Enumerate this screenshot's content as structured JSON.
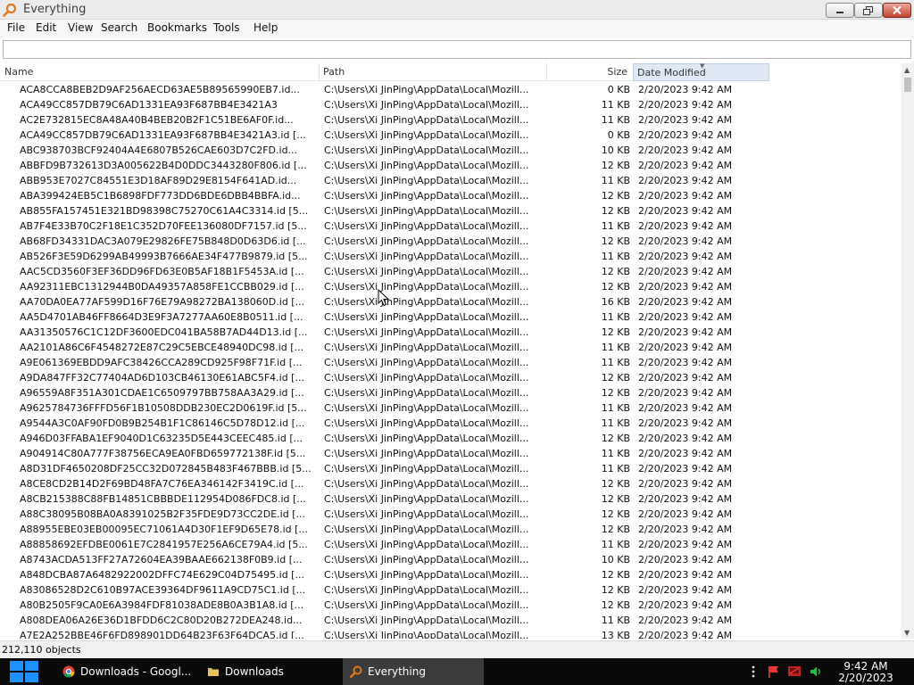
{
  "window": {
    "title": "Everything"
  },
  "menu": [
    "File",
    "Edit",
    "View",
    "Search",
    "Bookmarks",
    "Tools",
    "Help"
  ],
  "search": {
    "value": "",
    "placeholder": ""
  },
  "columns": {
    "name": "Name",
    "path": "Path",
    "size": "Size",
    "date": "Date Modified"
  },
  "rows": [
    {
      "name": "ACA8CCA8BEB2D9AF256AECD63AE5B89565990EB7.id...",
      "path": "C:\\Users\\Xi JinPing\\AppData\\Local\\Mozill...",
      "size": "0 KB",
      "date": "2/20/2023 9:42 AM"
    },
    {
      "name": "ACA49CC857DB79C6AD1331EA93F687BB4E3421A3",
      "path": "C:\\Users\\Xi JinPing\\AppData\\Local\\Mozill...",
      "size": "11 KB",
      "date": "2/20/2023 9:42 AM"
    },
    {
      "name": "AC2E732815EC8A48A40B4BEB20B2F1C51BE6AF0F.id...",
      "path": "C:\\Users\\Xi JinPing\\AppData\\Local\\Mozill...",
      "size": "11 KB",
      "date": "2/20/2023 9:42 AM"
    },
    {
      "name": "ACA49CC857DB79C6AD1331EA93F687BB4E3421A3.id [...",
      "path": "C:\\Users\\Xi JinPing\\AppData\\Local\\Mozill...",
      "size": "0 KB",
      "date": "2/20/2023 9:42 AM"
    },
    {
      "name": "ABC938703BCF92404A4E6807B526CAE603D7C2FD.id...",
      "path": "C:\\Users\\Xi JinPing\\AppData\\Local\\Mozill...",
      "size": "10 KB",
      "date": "2/20/2023 9:42 AM"
    },
    {
      "name": "ABBFD9B732613D3A005622B4D0DDC3443280F806.id [...",
      "path": "C:\\Users\\Xi JinPing\\AppData\\Local\\Mozill...",
      "size": "12 KB",
      "date": "2/20/2023 9:42 AM"
    },
    {
      "name": "ABB953E7027C84551E3D18AF89D29E8154F641AD.id...",
      "path": "C:\\Users\\Xi JinPing\\AppData\\Local\\Mozill...",
      "size": "11 KB",
      "date": "2/20/2023 9:42 AM"
    },
    {
      "name": "ABA399424EB5C1B6898FDF773DD6BDE6DBB4BBFA.id...",
      "path": "C:\\Users\\Xi JinPing\\AppData\\Local\\Mozill...",
      "size": "12 KB",
      "date": "2/20/2023 9:42 AM"
    },
    {
      "name": "AB855FA157451E321BD98398C75270C61A4C3314.id [5...",
      "path": "C:\\Users\\Xi JinPing\\AppData\\Local\\Mozill...",
      "size": "12 KB",
      "date": "2/20/2023 9:42 AM"
    },
    {
      "name": "AB7F4E33B70C2F18E1C352D70FEE136080DF7157.id [5...",
      "path": "C:\\Users\\Xi JinPing\\AppData\\Local\\Mozill...",
      "size": "11 KB",
      "date": "2/20/2023 9:42 AM"
    },
    {
      "name": "AB68FD34331DAC3A079E29826FE75B848D0D63D6.id [...",
      "path": "C:\\Users\\Xi JinPing\\AppData\\Local\\Mozill...",
      "size": "12 KB",
      "date": "2/20/2023 9:42 AM"
    },
    {
      "name": "AB526F3E59D6299AB49993B7666AE34F477B9879.id [5...",
      "path": "C:\\Users\\Xi JinPing\\AppData\\Local\\Mozill...",
      "size": "11 KB",
      "date": "2/20/2023 9:42 AM"
    },
    {
      "name": "AAC5CD3560F3EF36DD96FD63E0B5AF18B1F5453A.id [...",
      "path": "C:\\Users\\Xi JinPing\\AppData\\Local\\Mozill...",
      "size": "12 KB",
      "date": "2/20/2023 9:42 AM"
    },
    {
      "name": "AA92311EBC1312944B0DA49357A858FE1CCBB029.id [...",
      "path": "C:\\Users\\Xi JinPing\\AppData\\Local\\Mozill...",
      "size": "12 KB",
      "date": "2/20/2023 9:42 AM"
    },
    {
      "name": "AA70DA0EA77AF599D16F76E79A98272BA138060D.id [...",
      "path": "C:\\Users\\Xi JinPing\\AppData\\Local\\Mozill...",
      "size": "16 KB",
      "date": "2/20/2023 9:42 AM"
    },
    {
      "name": "AA5D4701AB46FF8664D3E9F3A7277AA60E8B0511.id [...",
      "path": "C:\\Users\\Xi JinPing\\AppData\\Local\\Mozill...",
      "size": "11 KB",
      "date": "2/20/2023 9:42 AM"
    },
    {
      "name": "AA31350576C1C12DF3600EDC041BA58B7AD44D13.id [...",
      "path": "C:\\Users\\Xi JinPing\\AppData\\Local\\Mozill...",
      "size": "12 KB",
      "date": "2/20/2023 9:42 AM"
    },
    {
      "name": "AA2101A86C6F4548272E87C29C5EBCE48940DC98.id [...",
      "path": "C:\\Users\\Xi JinPing\\AppData\\Local\\Mozill...",
      "size": "11 KB",
      "date": "2/20/2023 9:42 AM"
    },
    {
      "name": "A9E061369EBDD9AFC38426CCA289CD925F98F71F.id [...",
      "path": "C:\\Users\\Xi JinPing\\AppData\\Local\\Mozill...",
      "size": "11 KB",
      "date": "2/20/2023 9:42 AM"
    },
    {
      "name": "A9DA847FF32C77404AD6D103CB46130E61ABC5F4.id [...",
      "path": "C:\\Users\\Xi JinPing\\AppData\\Local\\Mozill...",
      "size": "12 KB",
      "date": "2/20/2023 9:42 AM"
    },
    {
      "name": "A96559A8F351A301CDAE1C6509797BB758AA3A29.id [...",
      "path": "C:\\Users\\Xi JinPing\\AppData\\Local\\Mozill...",
      "size": "12 KB",
      "date": "2/20/2023 9:42 AM"
    },
    {
      "name": "A9625784736FFFD56F1B10508DDB230EC2D0619F.id [5...",
      "path": "C:\\Users\\Xi JinPing\\AppData\\Local\\Mozill...",
      "size": "11 KB",
      "date": "2/20/2023 9:42 AM"
    },
    {
      "name": "A9544A3C0AF90FD0B9B254B1F1C86146C5D78D12.id [...",
      "path": "C:\\Users\\Xi JinPing\\AppData\\Local\\Mozill...",
      "size": "11 KB",
      "date": "2/20/2023 9:42 AM"
    },
    {
      "name": "A946D03FFABA1EF9040D1C63235D5E443CEEC485.id [...",
      "path": "C:\\Users\\Xi JinPing\\AppData\\Local\\Mozill...",
      "size": "12 KB",
      "date": "2/20/2023 9:42 AM"
    },
    {
      "name": "A904914C80A777F38756ECA9EA0FBD659772138F.id [5...",
      "path": "C:\\Users\\Xi JinPing\\AppData\\Local\\Mozill...",
      "size": "11 KB",
      "date": "2/20/2023 9:42 AM"
    },
    {
      "name": "A8D31DF4650208DF25CC32D072845B483F467BBB.id [5...",
      "path": "C:\\Users\\Xi JinPing\\AppData\\Local\\Mozill...",
      "size": "11 KB",
      "date": "2/20/2023 9:42 AM"
    },
    {
      "name": "A8CE8CD2B14D2F69BD48FA7C76EA346142F3419C.id [...",
      "path": "C:\\Users\\Xi JinPing\\AppData\\Local\\Mozill...",
      "size": "12 KB",
      "date": "2/20/2023 9:42 AM"
    },
    {
      "name": "A8CB215388C88FB14851CBBBDE112954D086FDC8.id [...",
      "path": "C:\\Users\\Xi JinPing\\AppData\\Local\\Mozill...",
      "size": "12 KB",
      "date": "2/20/2023 9:42 AM"
    },
    {
      "name": "A88C38095B08BA0A8391025B2F35FDE9D73CC2DE.id [...",
      "path": "C:\\Users\\Xi JinPing\\AppData\\Local\\Mozill...",
      "size": "12 KB",
      "date": "2/20/2023 9:42 AM"
    },
    {
      "name": "A88955EBE03EB00095EC71061A4D30F1EF9D65E78.id [...",
      "path": "C:\\Users\\Xi JinPing\\AppData\\Local\\Mozill...",
      "size": "12 KB",
      "date": "2/20/2023 9:42 AM"
    },
    {
      "name": "A88858692EFDBE0061E7C2841957E256A6CE79A4.id [5...",
      "path": "C:\\Users\\Xi JinPing\\AppData\\Local\\Mozill...",
      "size": "11 KB",
      "date": "2/20/2023 9:42 AM"
    },
    {
      "name": "A8743ACDA513FF27A72604EA39BAAE662138F0B9.id [...",
      "path": "C:\\Users\\Xi JinPing\\AppData\\Local\\Mozill...",
      "size": "10 KB",
      "date": "2/20/2023 9:42 AM"
    },
    {
      "name": "A848DCBA87A6482922002DFFC74E629C04D75495.id [...",
      "path": "C:\\Users\\Xi JinPing\\AppData\\Local\\Mozill...",
      "size": "12 KB",
      "date": "2/20/2023 9:42 AM"
    },
    {
      "name": "A83086528D2C610B97ACE39364DF9611A9CD75C1.id [...",
      "path": "C:\\Users\\Xi JinPing\\AppData\\Local\\Mozill...",
      "size": "12 KB",
      "date": "2/20/2023 9:42 AM"
    },
    {
      "name": "A80B2505F9CA0E6A3984FDF81038ADE8B0A3B1A8.id [...",
      "path": "C:\\Users\\Xi JinPing\\AppData\\Local\\Mozill...",
      "size": "12 KB",
      "date": "2/20/2023 9:42 AM"
    },
    {
      "name": "A808DEA06A26E36D1BFDD6C2C80D20B272DEA248.id...",
      "path": "C:\\Users\\Xi JinPing\\AppData\\Local\\Mozill...",
      "size": "11 KB",
      "date": "2/20/2023 9:42 AM"
    },
    {
      "name": "A7E2A252BBE46F6FD898901DD64B23F63F64DCA5.id [...",
      "path": "C:\\Users\\Xi JinPing\\AppData\\Local\\Mozill...",
      "size": "13 KB",
      "date": "2/20/2023 9:42 AM"
    }
  ],
  "status": {
    "text": "212,110 objects"
  },
  "taskbar": {
    "items": [
      {
        "label": "Downloads - Googl...",
        "icon": "chrome-icon",
        "active": false
      },
      {
        "label": "Downloads",
        "icon": "folder-icon",
        "active": false
      },
      {
        "label": "Everything",
        "icon": "everything-icon",
        "active": true
      }
    ],
    "clock": {
      "time": "9:42 AM",
      "date": "2/20/2023"
    }
  },
  "colors": {
    "header_highlight": "#dfe9f5",
    "taskbar": "#0a0a0a",
    "close_button": "#c6452f",
    "app_icon": "#e07a1f"
  }
}
